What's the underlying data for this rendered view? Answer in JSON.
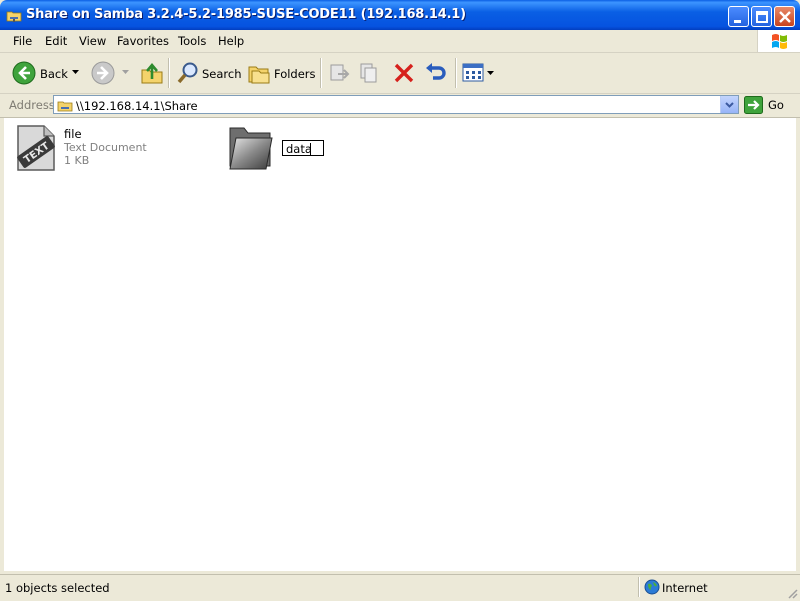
{
  "window": {
    "title": "Share on Samba 3.2.4-5.2-1985-SUSE-CODE11 (192.168.14.1)"
  },
  "menu": {
    "items": [
      "File",
      "Edit",
      "View",
      "Favorites",
      "Tools",
      "Help"
    ]
  },
  "toolbar": {
    "back_label": "Back",
    "search_label": "Search",
    "folders_label": "Folders"
  },
  "address": {
    "label": "Address",
    "value": "\\\\192.168.14.1\\Share",
    "go_label": "Go"
  },
  "content": {
    "items": [
      {
        "name": "file",
        "type": "Text Document",
        "size": "1 KB",
        "icon": "text-document-icon"
      },
      {
        "name": "data",
        "type": "",
        "size": "",
        "icon": "folder-icon",
        "renaming": true
      }
    ]
  },
  "status": {
    "selection": "1 objects selected",
    "zone": "Internet"
  },
  "colors": {
    "titlebar": "#0a5fe4",
    "chrome": "#ece9d8",
    "content_bg": "#ffffff",
    "close_red": "#c8431d"
  }
}
